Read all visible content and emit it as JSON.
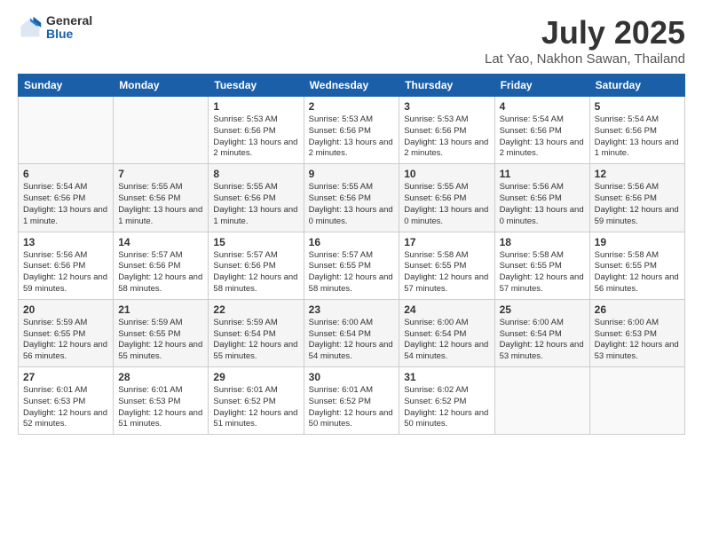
{
  "logo": {
    "general": "General",
    "blue": "Blue"
  },
  "title": "July 2025",
  "location": "Lat Yao, Nakhon Sawan, Thailand",
  "weekdays": [
    "Sunday",
    "Monday",
    "Tuesday",
    "Wednesday",
    "Thursday",
    "Friday",
    "Saturday"
  ],
  "weeks": [
    [
      {
        "day": "",
        "sunrise": "",
        "sunset": "",
        "daylight": ""
      },
      {
        "day": "",
        "sunrise": "",
        "sunset": "",
        "daylight": ""
      },
      {
        "day": "1",
        "sunrise": "Sunrise: 5:53 AM",
        "sunset": "Sunset: 6:56 PM",
        "daylight": "Daylight: 13 hours and 2 minutes."
      },
      {
        "day": "2",
        "sunrise": "Sunrise: 5:53 AM",
        "sunset": "Sunset: 6:56 PM",
        "daylight": "Daylight: 13 hours and 2 minutes."
      },
      {
        "day": "3",
        "sunrise": "Sunrise: 5:53 AM",
        "sunset": "Sunset: 6:56 PM",
        "daylight": "Daylight: 13 hours and 2 minutes."
      },
      {
        "day": "4",
        "sunrise": "Sunrise: 5:54 AM",
        "sunset": "Sunset: 6:56 PM",
        "daylight": "Daylight: 13 hours and 2 minutes."
      },
      {
        "day": "5",
        "sunrise": "Sunrise: 5:54 AM",
        "sunset": "Sunset: 6:56 PM",
        "daylight": "Daylight: 13 hours and 1 minute."
      }
    ],
    [
      {
        "day": "6",
        "sunrise": "Sunrise: 5:54 AM",
        "sunset": "Sunset: 6:56 PM",
        "daylight": "Daylight: 13 hours and 1 minute."
      },
      {
        "day": "7",
        "sunrise": "Sunrise: 5:55 AM",
        "sunset": "Sunset: 6:56 PM",
        "daylight": "Daylight: 13 hours and 1 minute."
      },
      {
        "day": "8",
        "sunrise": "Sunrise: 5:55 AM",
        "sunset": "Sunset: 6:56 PM",
        "daylight": "Daylight: 13 hours and 1 minute."
      },
      {
        "day": "9",
        "sunrise": "Sunrise: 5:55 AM",
        "sunset": "Sunset: 6:56 PM",
        "daylight": "Daylight: 13 hours and 0 minutes."
      },
      {
        "day": "10",
        "sunrise": "Sunrise: 5:55 AM",
        "sunset": "Sunset: 6:56 PM",
        "daylight": "Daylight: 13 hours and 0 minutes."
      },
      {
        "day": "11",
        "sunrise": "Sunrise: 5:56 AM",
        "sunset": "Sunset: 6:56 PM",
        "daylight": "Daylight: 13 hours and 0 minutes."
      },
      {
        "day": "12",
        "sunrise": "Sunrise: 5:56 AM",
        "sunset": "Sunset: 6:56 PM",
        "daylight": "Daylight: 12 hours and 59 minutes."
      }
    ],
    [
      {
        "day": "13",
        "sunrise": "Sunrise: 5:56 AM",
        "sunset": "Sunset: 6:56 PM",
        "daylight": "Daylight: 12 hours and 59 minutes."
      },
      {
        "day": "14",
        "sunrise": "Sunrise: 5:57 AM",
        "sunset": "Sunset: 6:56 PM",
        "daylight": "Daylight: 12 hours and 58 minutes."
      },
      {
        "day": "15",
        "sunrise": "Sunrise: 5:57 AM",
        "sunset": "Sunset: 6:56 PM",
        "daylight": "Daylight: 12 hours and 58 minutes."
      },
      {
        "day": "16",
        "sunrise": "Sunrise: 5:57 AM",
        "sunset": "Sunset: 6:55 PM",
        "daylight": "Daylight: 12 hours and 58 minutes."
      },
      {
        "day": "17",
        "sunrise": "Sunrise: 5:58 AM",
        "sunset": "Sunset: 6:55 PM",
        "daylight": "Daylight: 12 hours and 57 minutes."
      },
      {
        "day": "18",
        "sunrise": "Sunrise: 5:58 AM",
        "sunset": "Sunset: 6:55 PM",
        "daylight": "Daylight: 12 hours and 57 minutes."
      },
      {
        "day": "19",
        "sunrise": "Sunrise: 5:58 AM",
        "sunset": "Sunset: 6:55 PM",
        "daylight": "Daylight: 12 hours and 56 minutes."
      }
    ],
    [
      {
        "day": "20",
        "sunrise": "Sunrise: 5:59 AM",
        "sunset": "Sunset: 6:55 PM",
        "daylight": "Daylight: 12 hours and 56 minutes."
      },
      {
        "day": "21",
        "sunrise": "Sunrise: 5:59 AM",
        "sunset": "Sunset: 6:55 PM",
        "daylight": "Daylight: 12 hours and 55 minutes."
      },
      {
        "day": "22",
        "sunrise": "Sunrise: 5:59 AM",
        "sunset": "Sunset: 6:54 PM",
        "daylight": "Daylight: 12 hours and 55 minutes."
      },
      {
        "day": "23",
        "sunrise": "Sunrise: 6:00 AM",
        "sunset": "Sunset: 6:54 PM",
        "daylight": "Daylight: 12 hours and 54 minutes."
      },
      {
        "day": "24",
        "sunrise": "Sunrise: 6:00 AM",
        "sunset": "Sunset: 6:54 PM",
        "daylight": "Daylight: 12 hours and 54 minutes."
      },
      {
        "day": "25",
        "sunrise": "Sunrise: 6:00 AM",
        "sunset": "Sunset: 6:54 PM",
        "daylight": "Daylight: 12 hours and 53 minutes."
      },
      {
        "day": "26",
        "sunrise": "Sunrise: 6:00 AM",
        "sunset": "Sunset: 6:53 PM",
        "daylight": "Daylight: 12 hours and 53 minutes."
      }
    ],
    [
      {
        "day": "27",
        "sunrise": "Sunrise: 6:01 AM",
        "sunset": "Sunset: 6:53 PM",
        "daylight": "Daylight: 12 hours and 52 minutes."
      },
      {
        "day": "28",
        "sunrise": "Sunrise: 6:01 AM",
        "sunset": "Sunset: 6:53 PM",
        "daylight": "Daylight: 12 hours and 51 minutes."
      },
      {
        "day": "29",
        "sunrise": "Sunrise: 6:01 AM",
        "sunset": "Sunset: 6:52 PM",
        "daylight": "Daylight: 12 hours and 51 minutes."
      },
      {
        "day": "30",
        "sunrise": "Sunrise: 6:01 AM",
        "sunset": "Sunset: 6:52 PM",
        "daylight": "Daylight: 12 hours and 50 minutes."
      },
      {
        "day": "31",
        "sunrise": "Sunrise: 6:02 AM",
        "sunset": "Sunset: 6:52 PM",
        "daylight": "Daylight: 12 hours and 50 minutes."
      },
      {
        "day": "",
        "sunrise": "",
        "sunset": "",
        "daylight": ""
      },
      {
        "day": "",
        "sunrise": "",
        "sunset": "",
        "daylight": ""
      }
    ]
  ]
}
